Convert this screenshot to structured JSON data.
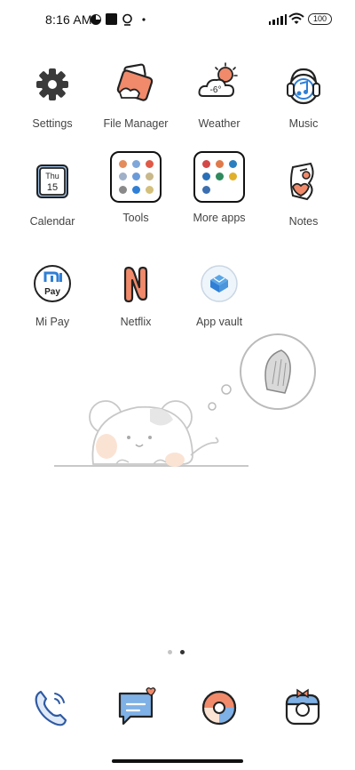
{
  "status_bar": {
    "time": "8:16 AM",
    "battery": "100",
    "icons": [
      "notification-icon",
      "square-icon",
      "assistant-icon",
      "dot-icon",
      "signal-icon",
      "wifi-icon",
      "battery-icon"
    ]
  },
  "apps": [
    {
      "label": "Settings",
      "icon": "gear-icon"
    },
    {
      "label": "File Manager",
      "icon": "folder-icon"
    },
    {
      "label": "Weather",
      "icon": "weather-icon",
      "temp": "-6°"
    },
    {
      "label": "Music",
      "icon": "music-icon"
    },
    {
      "label": "Calendar",
      "icon": "calendar-icon",
      "day": "Thu",
      "date": "15"
    },
    {
      "label": "Tools",
      "icon": "folder-tools-icon"
    },
    {
      "label": "More apps",
      "icon": "folder-more-apps-icon"
    },
    {
      "label": "Notes",
      "icon": "notes-icon"
    },
    {
      "label": "Mi Pay",
      "icon": "mi-pay-icon",
      "text": "Pay"
    },
    {
      "label": "Netflix",
      "icon": "netflix-icon"
    },
    {
      "label": "App vault",
      "icon": "app-vault-icon"
    }
  ],
  "dock": [
    {
      "icon": "phone-icon"
    },
    {
      "icon": "messages-icon"
    },
    {
      "icon": "browser-icon"
    },
    {
      "icon": "camera-icon"
    }
  ],
  "pages": {
    "count": 2,
    "active": 2
  },
  "colors": {
    "accent": "#f08a6b",
    "ink": "#222222",
    "blue": "#2f7fd6",
    "label": "#444444"
  }
}
